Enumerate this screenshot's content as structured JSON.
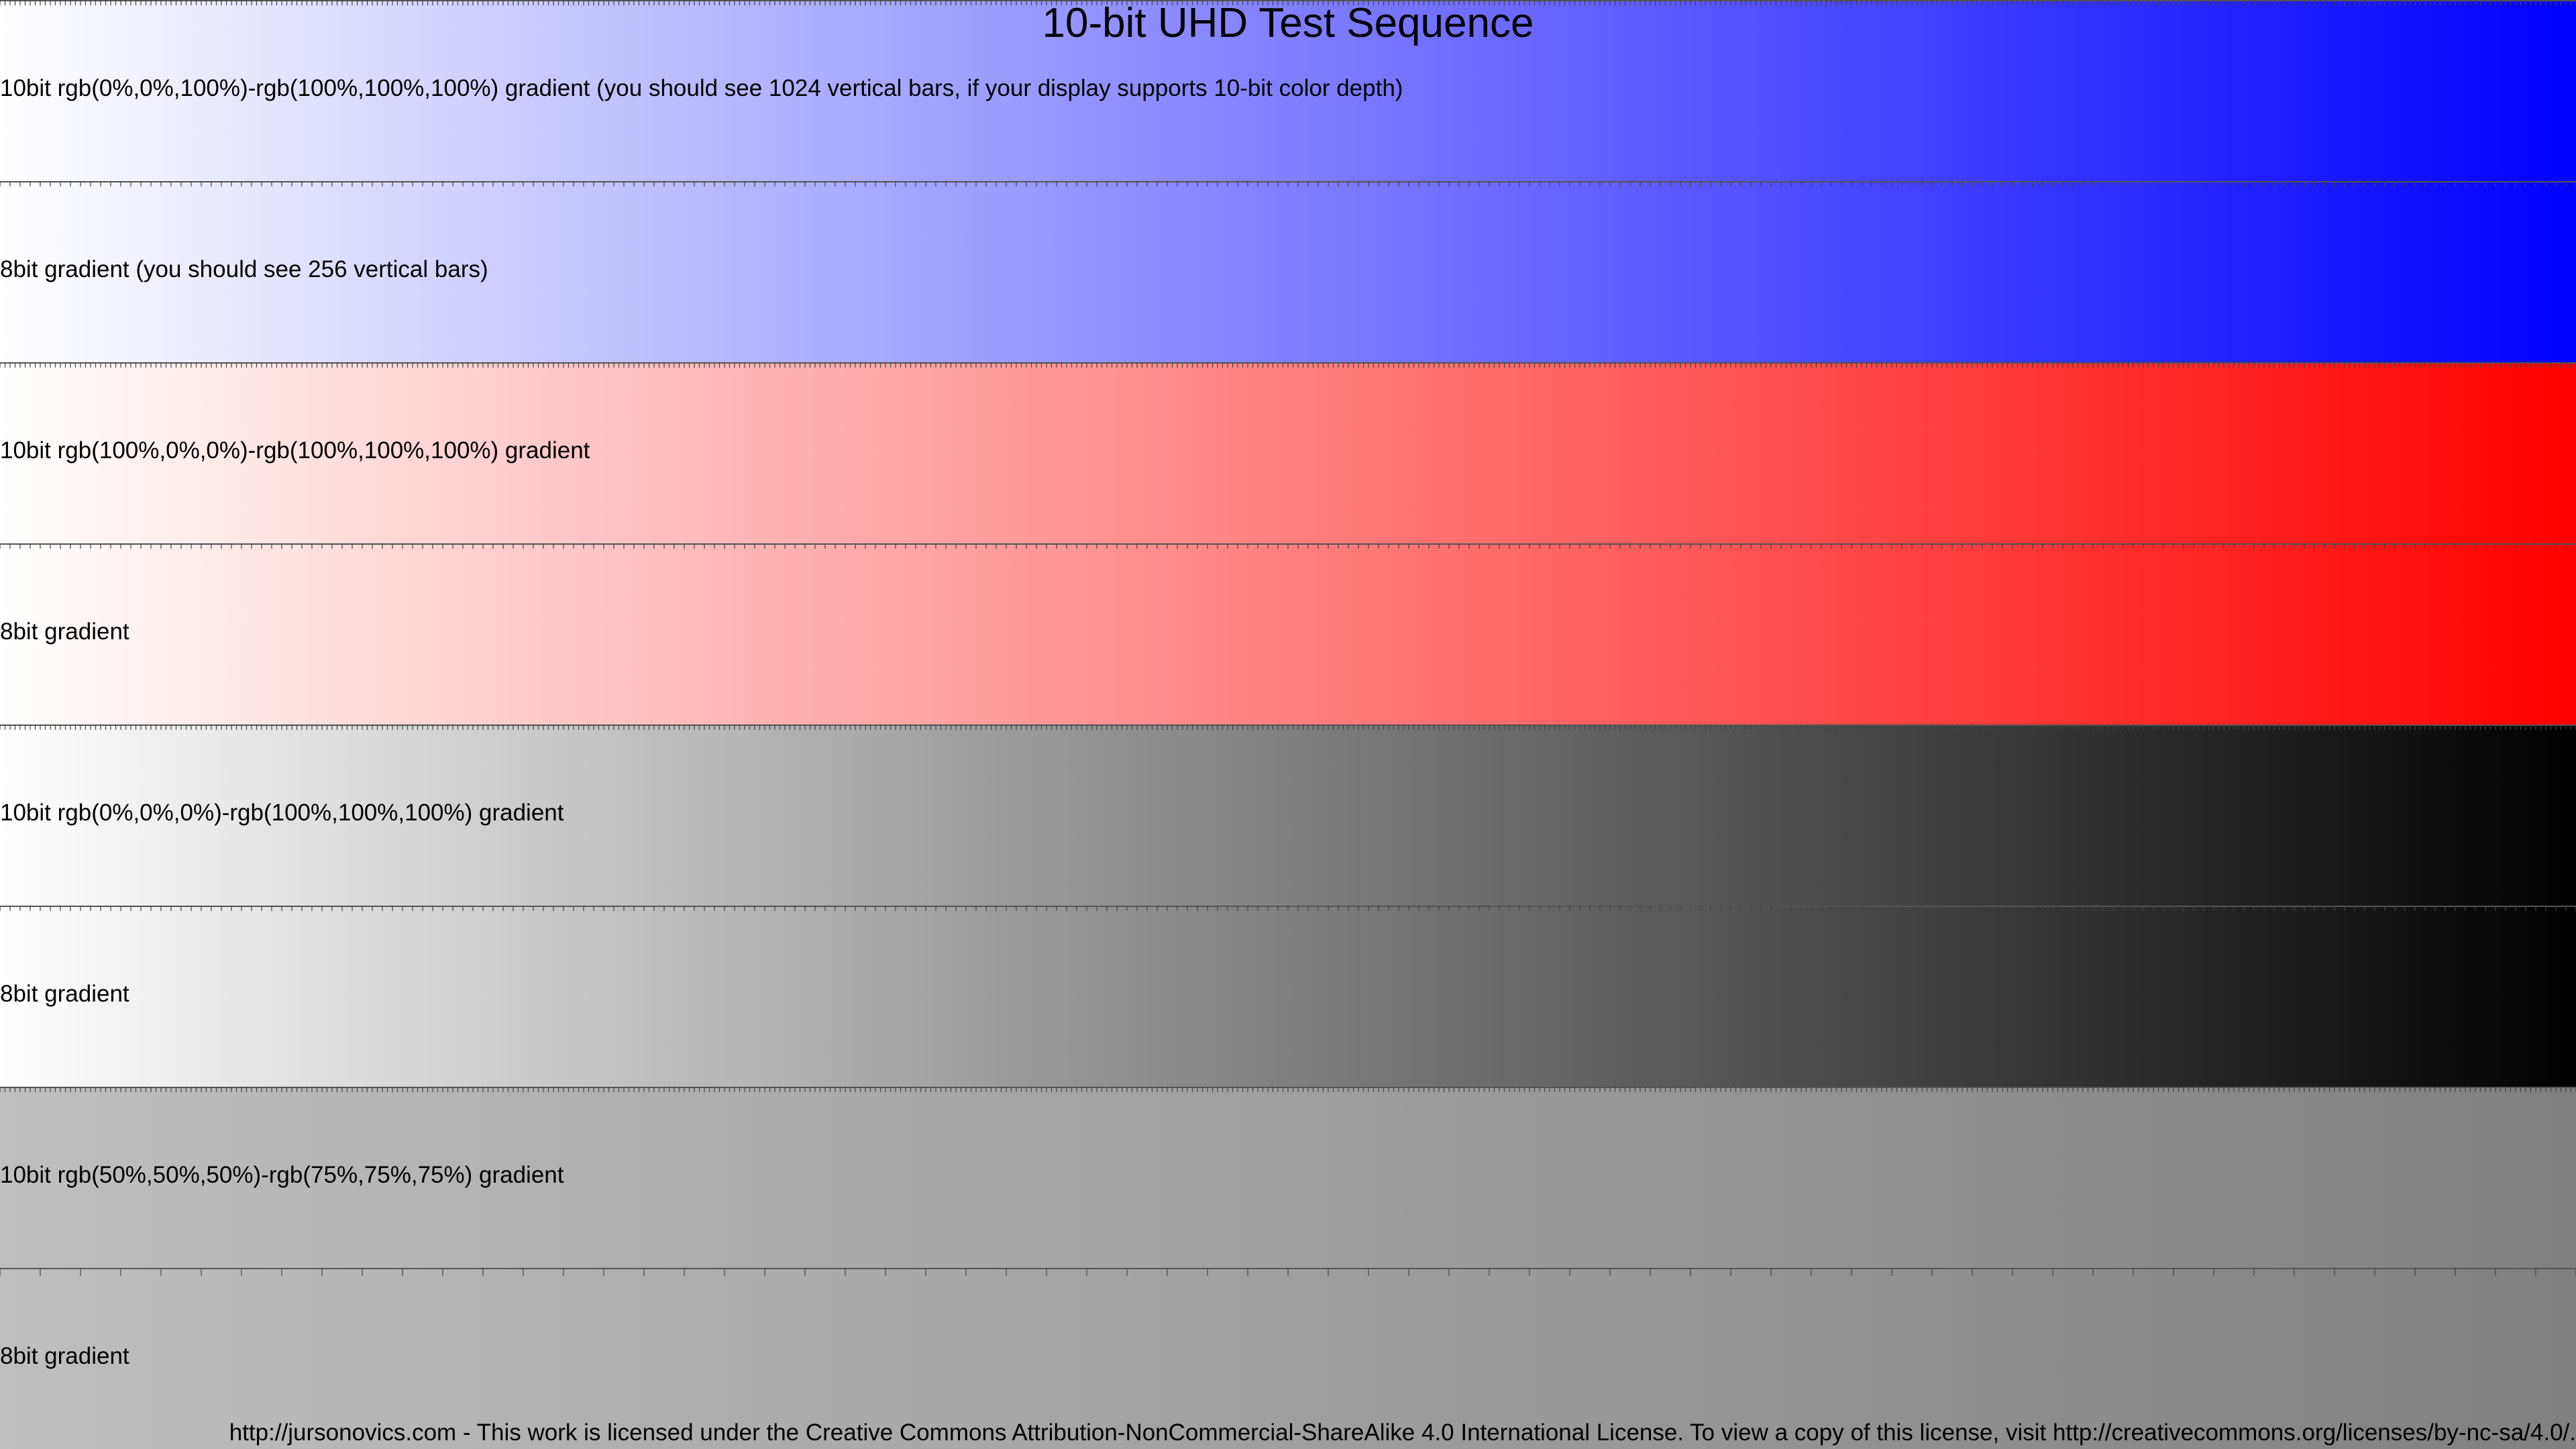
{
  "title": "10-bit UHD Test Sequence",
  "bands": [
    {
      "label": "10bit rgb(0%,0%,100%)-rgb(100%,100%,100%) gradient (you should see 1024 vertical bars, if your display supports 10-bit color depth)",
      "bits": 10,
      "from": "#ffffff",
      "to": "#0000ff"
    },
    {
      "label": "8bit gradient (you should see 256 vertical bars)",
      "bits": 8,
      "from": "#ffffff",
      "to": "#0000ff"
    },
    {
      "label": "10bit rgb(100%,0%,0%)-rgb(100%,100%,100%) gradient",
      "bits": 10,
      "from": "#ffffff",
      "to": "#ff0000"
    },
    {
      "label": "8bit gradient",
      "bits": 8,
      "from": "#ffffff",
      "to": "#ff0000"
    },
    {
      "label": "10bit rgb(0%,0%,0%)-rgb(100%,100%,100%) gradient",
      "bits": 10,
      "from": "#ffffff",
      "to": "#000000"
    },
    {
      "label": "8bit gradient",
      "bits": 8,
      "from": "#ffffff",
      "to": "#000000"
    },
    {
      "label": "10bit rgb(50%,50%,50%)-rgb(75%,75%,75%) gradient",
      "bits": 10,
      "from": "#bfbfbf",
      "to": "#808080"
    },
    {
      "label": "8bit gradient",
      "bits": 8,
      "from": "#bfbfbf",
      "to": "#808080"
    }
  ],
  "footer": "http://jursonovics.com - This work is licensed under the Creative Commons Attribution-NonCommercial-ShareAlike 4.0 International License. To view a copy of this license, visit http://creativecommons.org/licenses/by-nc-sa/4.0/."
}
